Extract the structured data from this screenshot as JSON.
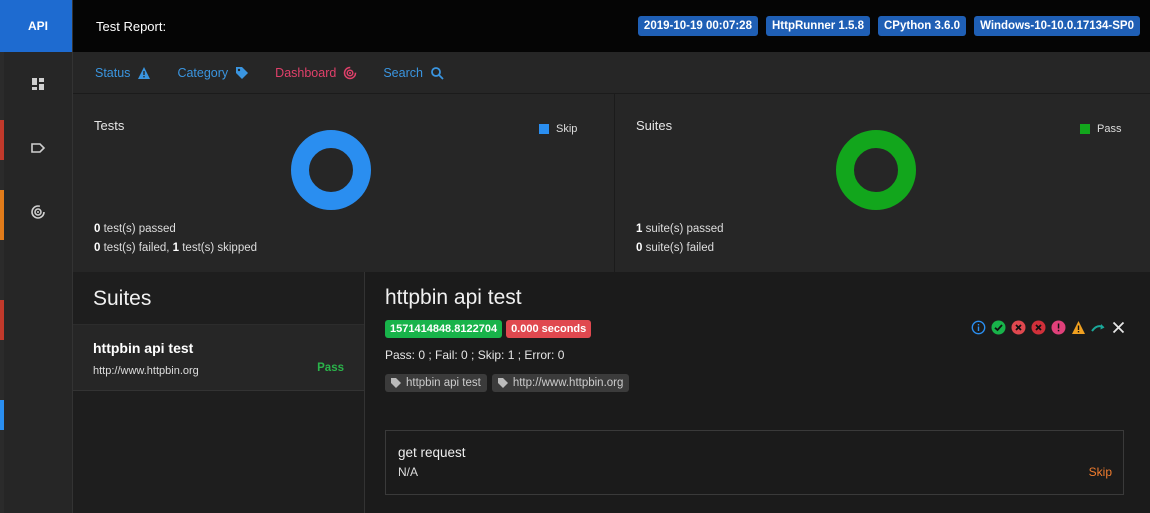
{
  "colors": {
    "brand": "#1e6bd0",
    "pass": "#18b34a",
    "fail": "#e0484f",
    "skip": "#2a8ef0",
    "accent_nav": "#3a95e0",
    "nav_active": "#e0406a",
    "skip_text": "#f07c2e"
  },
  "sidebar": {
    "brand": "API",
    "items": [
      {
        "icon": "dashboard-grid-icon"
      },
      {
        "icon": "tag-icon"
      },
      {
        "icon": "radar-icon"
      }
    ]
  },
  "topbar": {
    "title": "Test Report:",
    "badges": [
      "2019-10-19 00:07:28",
      "HttpRunner 1.5.8",
      "CPython 3.6.0",
      "Windows-10-10.0.17134-SP0"
    ]
  },
  "nav": [
    {
      "label": "Status",
      "icon": "warning-triangle-icon"
    },
    {
      "label": "Category",
      "icon": "tag-icon"
    },
    {
      "label": "Dashboard",
      "icon": "radar-icon",
      "active": true
    },
    {
      "label": "Search",
      "icon": "search-icon"
    }
  ],
  "tests_card": {
    "title": "Tests",
    "legend": "Skip",
    "passed_count": "0",
    "passed_text": " test(s) passed",
    "failed_count": "0",
    "failed_text": " test(s) failed, ",
    "skipped_count": "1",
    "skipped_text": " test(s) skipped",
    "chart": {
      "pass": 0,
      "fail": 0,
      "skip": 1
    }
  },
  "suites_card": {
    "title": "Suites",
    "legend": "Pass",
    "passed_count": "1",
    "passed_text": " suite(s) passed",
    "failed_count": "0",
    "failed_text": " suite(s) failed",
    "chart": {
      "pass": 1,
      "fail": 0
    }
  },
  "suites_panel": {
    "title": "Suites",
    "items": [
      {
        "name": "httpbin api test",
        "url": "http://www.httpbin.org",
        "status": "Pass"
      }
    ]
  },
  "detail": {
    "title": "httpbin api test",
    "start_time": "1571414848.8122704",
    "duration": "0.000 seconds",
    "counts": "Pass: 0 ; Fail: 0 ; Skip: 1 ; Error: 0",
    "tags": [
      "httpbin api test",
      "http://www.httpbin.org"
    ],
    "filters": [
      "info-circle-icon",
      "pass-check-icon",
      "fail-x-icon",
      "error-x-icon",
      "exception-icon",
      "warning-icon",
      "skip-arrow-icon",
      "clear-x-icon"
    ],
    "test": {
      "name": "get request",
      "description": "N/A",
      "status": "Skip"
    }
  }
}
